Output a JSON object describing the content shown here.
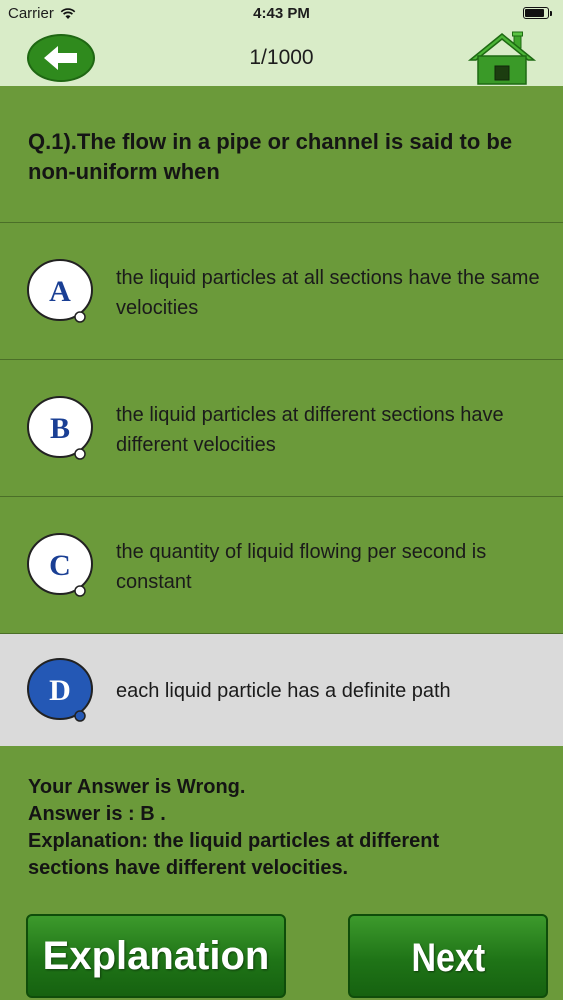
{
  "status": {
    "carrier": "Carrier",
    "time": "4:43 PM",
    "battery_level": 0.92
  },
  "nav": {
    "title": "1/1000",
    "back_icon": "back-arrow-icon",
    "home_icon": "home-icon"
  },
  "question": {
    "text": "Q.1).The flow in a pipe or channel is said to be non-uniform when"
  },
  "options": [
    {
      "letter": "A",
      "text": "the liquid particles at all sections have the same velocities"
    },
    {
      "letter": "B",
      "text": "the liquid particles at different sections have different velocities"
    },
    {
      "letter": "C",
      "text": "the quantity of liquid flowing per second is constant"
    },
    {
      "letter": "D",
      "text": "each liquid particle has a definite path",
      "selected": true
    }
  ],
  "result": {
    "verdict": "Your Answer is Wrong.",
    "answer": "Answer is : B .",
    "explanation_line1": "Explanation: the liquid particles at different",
    "explanation_line2": "sections have different velocities."
  },
  "buttons": {
    "explanation": "Explanation",
    "next": "Next"
  },
  "colors": {
    "background": "#6b9a3a",
    "header": "#d9ecc8",
    "selected": "#dadada",
    "accent": "#1f7417",
    "selected_bubble": "#2458b5"
  }
}
